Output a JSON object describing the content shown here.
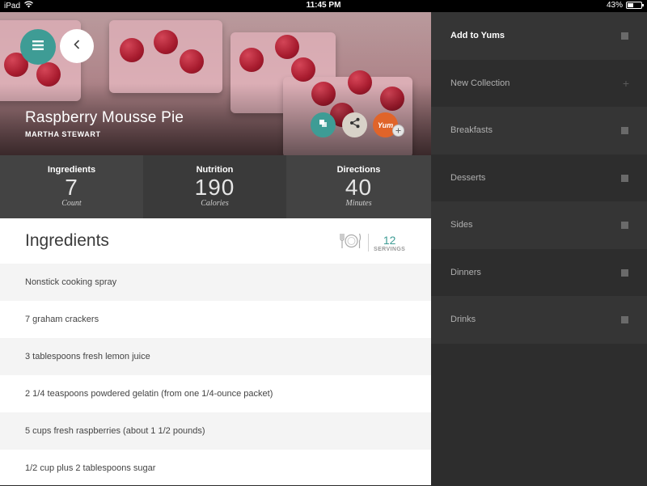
{
  "status_bar": {
    "device": "iPad",
    "time": "11:45 PM",
    "battery": "43%",
    "battery_level": 0.43
  },
  "recipe": {
    "title": "Raspberry Mousse Pie",
    "source": "MARTHA STEWART",
    "yum_label": "Yum"
  },
  "stats": [
    {
      "label": "Ingredients",
      "value": "7",
      "unit": "Count"
    },
    {
      "label": "Nutrition",
      "value": "190",
      "unit": "Calories"
    },
    {
      "label": "Directions",
      "value": "40",
      "unit": "Minutes"
    }
  ],
  "ingredients_section": {
    "title": "Ingredients",
    "servings_count": "12",
    "servings_label": "SERVINGS"
  },
  "ingredients": [
    "Nonstick cooking spray",
    "7 graham crackers",
    "3 tablespoons fresh lemon juice",
    "2 1/4 teaspoons powdered gelatin (from one  1/4-ounce packet)",
    "5 cups fresh raspberries (about 1 1/2 pounds)",
    "1/2 cup plus 2 tablespoons sugar"
  ],
  "sidebar": {
    "items": [
      {
        "label": "Add to Yums",
        "marker": "checkbox"
      },
      {
        "label": "New Collection",
        "marker": "plus"
      },
      {
        "label": "Breakfasts",
        "marker": "checkbox"
      },
      {
        "label": "Desserts",
        "marker": "checkbox"
      },
      {
        "label": "Sides",
        "marker": "checkbox"
      },
      {
        "label": "Dinners",
        "marker": "checkbox"
      },
      {
        "label": "Drinks",
        "marker": "checkbox"
      }
    ]
  },
  "colors": {
    "teal": "#3e9c95",
    "orange": "#e0642a",
    "sidebar_bg": "#2b2b2b"
  }
}
